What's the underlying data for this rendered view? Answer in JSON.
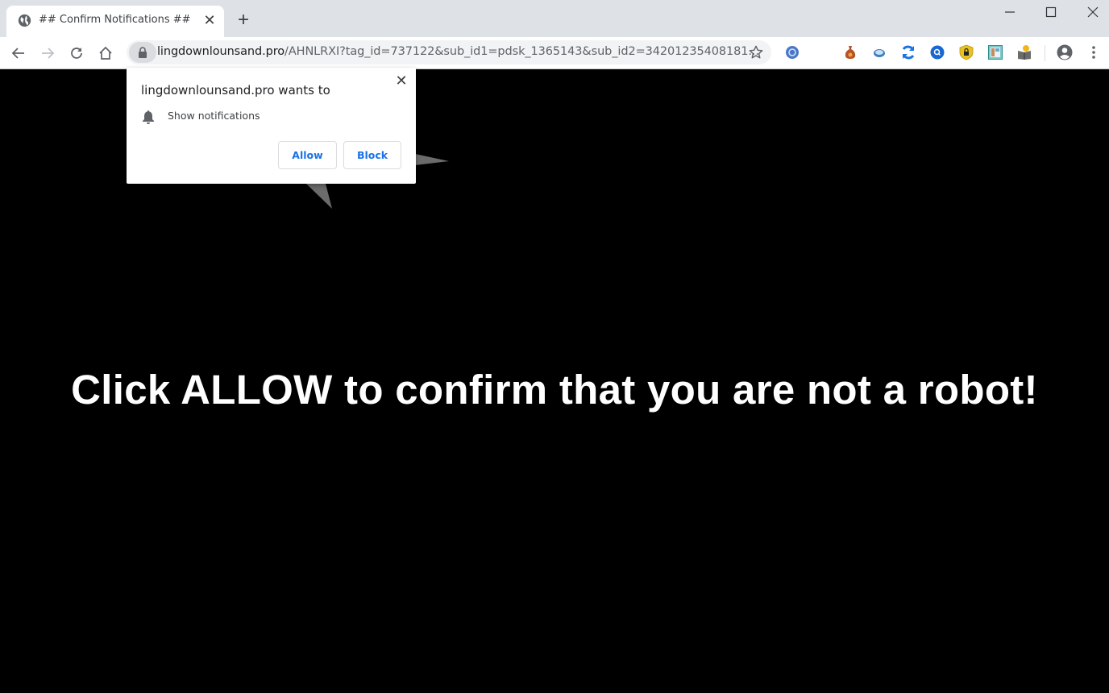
{
  "browser": {
    "tab": {
      "title": "## Confirm Notifications ##",
      "icon": "globe-icon",
      "close_label": "✕"
    },
    "new_tab_label": "+",
    "window_controls": {
      "minimize": "minimize-icon",
      "maximize": "maximize-icon",
      "close": "close-icon"
    },
    "nav": {
      "back": "back-arrow-icon",
      "forward": "forward-arrow-icon",
      "reload": "reload-icon",
      "home": "home-icon"
    },
    "address": {
      "domain": "lingdownlounsand.pro",
      "path": "/AHNLRXI?tag_id=737122&sub_id1=pdsk_1365143&sub_id2=34201235408181..."
    },
    "extensions": [
      {
        "name": "blue-orb-extension-icon",
        "color": "#4a78c8"
      },
      {
        "name": "money-bag-extension-icon",
        "color": "#c0602a"
      },
      {
        "name": "oval-extension-icon",
        "color": "#3a7fc0"
      },
      {
        "name": "sync-extension-icon",
        "color": "#1a73e8"
      },
      {
        "name": "search-extension-icon",
        "color": "#1967d2"
      },
      {
        "name": "shield-lock-extension-icon",
        "color": "#e8c31f"
      },
      {
        "name": "window-extension-icon",
        "color": "#39a5a5"
      },
      {
        "name": "book-extension-icon",
        "color": "#f2b61a"
      }
    ]
  },
  "popup": {
    "title": "lingdownlounsand.pro wants to",
    "permission": "Show notifications",
    "close_label": "✕",
    "allow_label": "Allow",
    "block_label": "Block"
  },
  "page": {
    "headline": "Click ALLOW to confirm that you are not a robot!",
    "background_color": "#000000",
    "text_color": "#ffffff"
  }
}
